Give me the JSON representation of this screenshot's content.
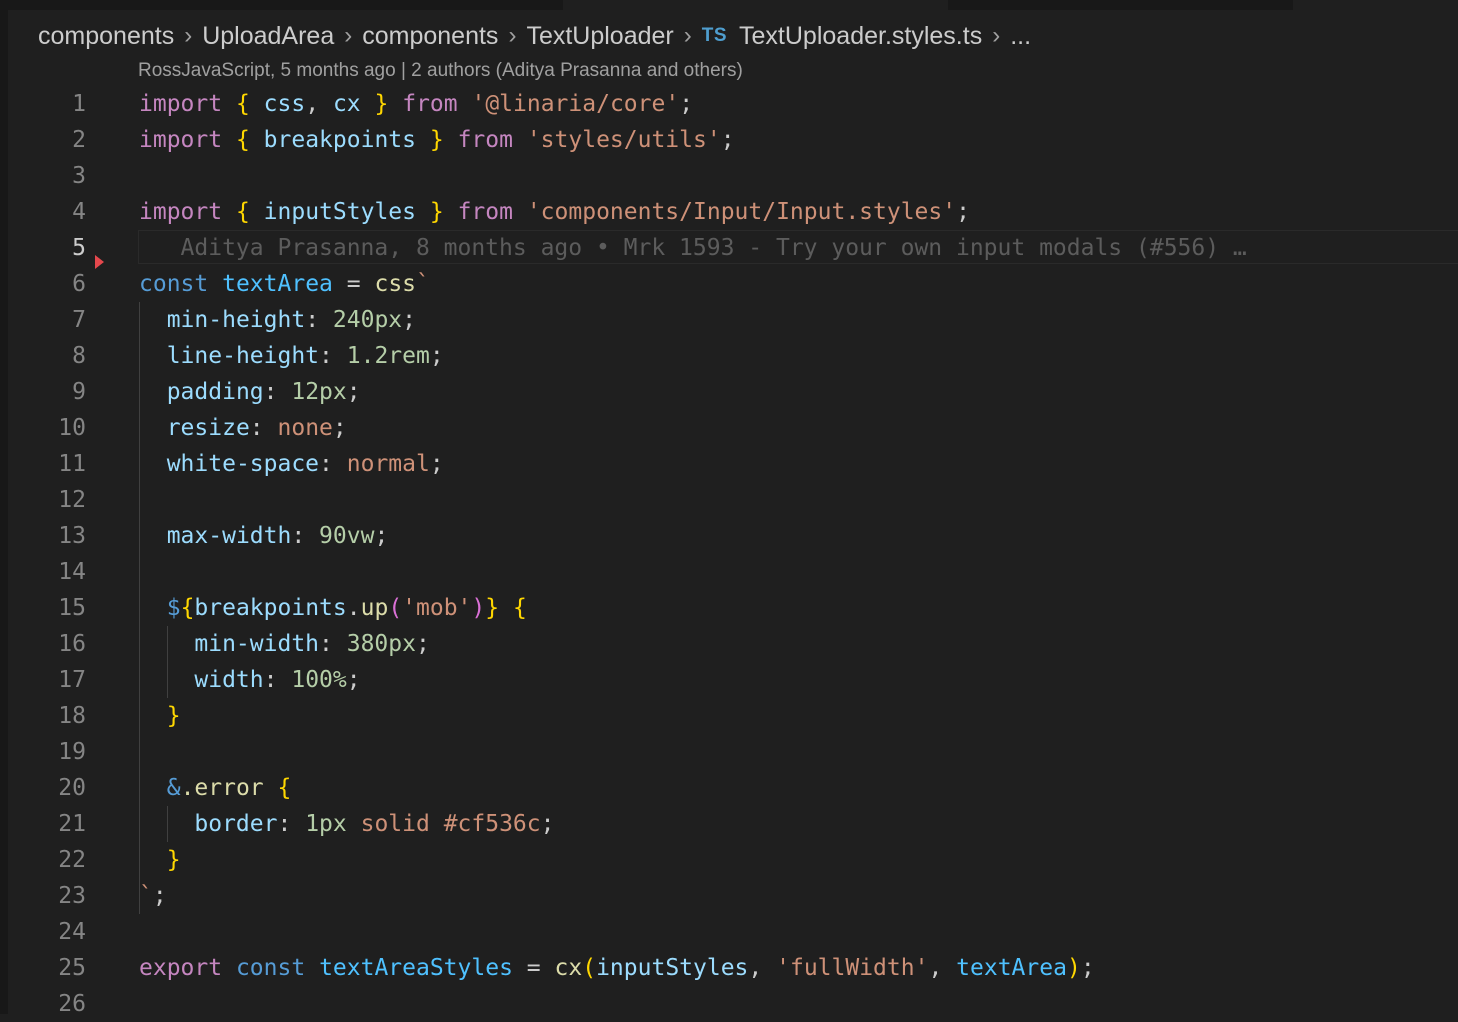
{
  "breadcrumb": {
    "items": [
      "components",
      "UploadArea",
      "components",
      "TextUploader"
    ],
    "file_lang_badge": "TS",
    "file_name": "TextUploader.styles.ts",
    "more": "..."
  },
  "codelens": {
    "blame_summary": "RossJavaScript, 5 months ago | 2 authors (Aditya Prasanna and others)"
  },
  "editor": {
    "current_line": 5,
    "inline_blame": "Aditya Prasanna, 8 months ago • Mrk 1593 - Try your own input modals (#556) …",
    "line_numbers": [
      "1",
      "2",
      "3",
      "4",
      "5",
      "6",
      "7",
      "8",
      "9",
      "10",
      "11",
      "12",
      "13",
      "14",
      "15",
      "16",
      "17",
      "18",
      "19",
      "20",
      "21",
      "22",
      "23",
      "24",
      "25",
      "26"
    ],
    "code": {
      "l1": {
        "import": "import",
        "ob": "{",
        "a": "css",
        "comma": ",",
        "b": "cx",
        "cb": "}",
        "from": "from",
        "src": "'@linaria/core'",
        "semi": ";"
      },
      "l2": {
        "import": "import",
        "ob": "{",
        "a": "breakpoints",
        "cb": "}",
        "from": "from",
        "src": "'styles/utils'",
        "semi": ";"
      },
      "l4": {
        "import": "import",
        "ob": "{",
        "a": "inputStyles",
        "cb": "}",
        "from": "from",
        "src": "'components/Input/Input.styles'",
        "semi": ";"
      },
      "l6": {
        "const": "const",
        "name": "textArea",
        "eq": "=",
        "tag": "css",
        "tick": "`"
      },
      "l7": {
        "prop": "min-height",
        "colon": ":",
        "val": "240px",
        "semi": ";"
      },
      "l8": {
        "prop": "line-height",
        "colon": ":",
        "val": "1.2rem",
        "semi": ";"
      },
      "l9": {
        "prop": "padding",
        "colon": ":",
        "val": "12px",
        "semi": ";"
      },
      "l10": {
        "prop": "resize",
        "colon": ":",
        "val": "none",
        "semi": ";"
      },
      "l11": {
        "prop": "white-space",
        "colon": ":",
        "val": "normal",
        "semi": ";"
      },
      "l13": {
        "prop": "max-width",
        "colon": ":",
        "val": "90vw",
        "semi": ";"
      },
      "l15": {
        "dollar": "$",
        "ob": "{",
        "obj": "breakpoints",
        "dot": ".",
        "method": "up",
        "op": "(",
        "arg": "'mob'",
        "cp": ")",
        "cb": "}",
        "block": "{"
      },
      "l16": {
        "prop": "min-width",
        "colon": ":",
        "val": "380px",
        "semi": ";"
      },
      "l17": {
        "prop": "width",
        "colon": ":",
        "val": "100%",
        "semi": ";"
      },
      "l18": {
        "cb": "}"
      },
      "l20": {
        "amp": "&",
        "sel": ".error",
        "block": "{"
      },
      "l21": {
        "prop": "border",
        "colon": ":",
        "v1": "1px",
        "v2": "solid #cf536c",
        "semi": ";"
      },
      "l22": {
        "cb": "}"
      },
      "l23": {
        "tick": "`",
        "semi": ";"
      },
      "l25": {
        "export": "export",
        "const": "const",
        "name": "textAreaStyles",
        "eq": "=",
        "fn": "cx",
        "op": "(",
        "a1": "inputStyles",
        "comma1": ",",
        "a2": "'fullWidth'",
        "comma2": ",",
        "a3": "textArea",
        "cp": ")",
        "semi": ";"
      }
    }
  }
}
